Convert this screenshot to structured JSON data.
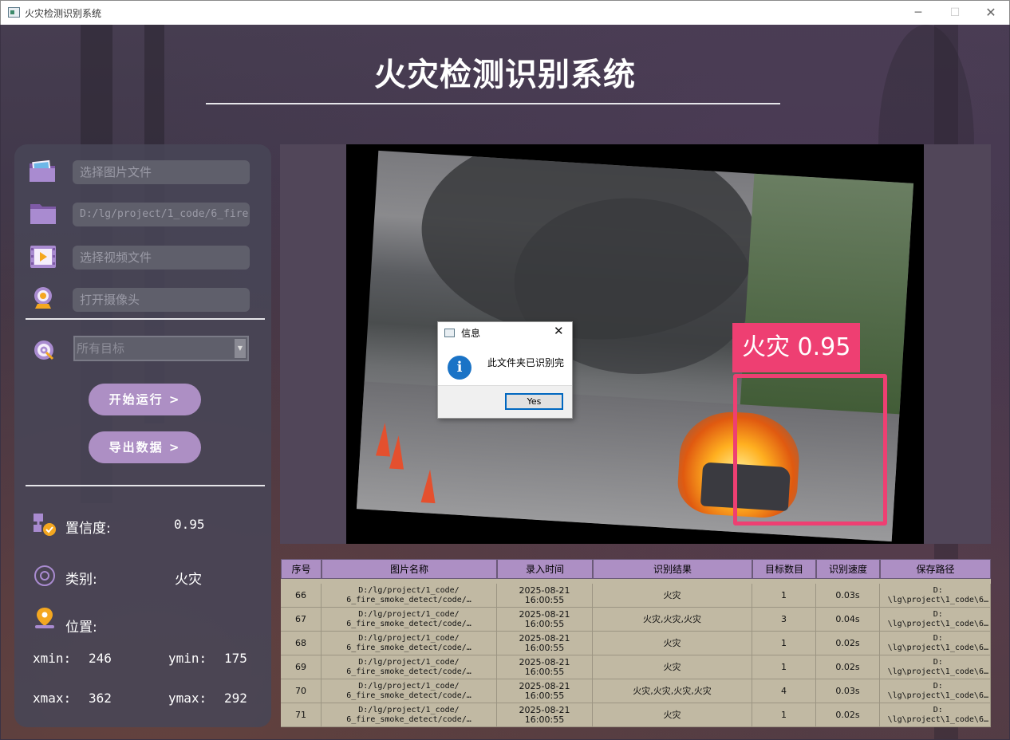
{
  "window": {
    "title": "火灾检测识别系统",
    "controls": {
      "minimize": "─",
      "maximize": "☐",
      "close": "✕"
    }
  },
  "header": {
    "title": "火灾检测识别系统"
  },
  "sidebar": {
    "image_file": {
      "placeholder": "选择图片文件",
      "icon": "image-folder-icon"
    },
    "folder": {
      "value": "D:/lg/project/1_code/6_fire",
      "icon": "folder-icon"
    },
    "video_file": {
      "placeholder": "选择视频文件",
      "icon": "video-icon"
    },
    "camera": {
      "placeholder": "打开摄像头",
      "icon": "webcam-icon"
    },
    "target_select": {
      "value": "所有目标",
      "icon": "target-icon"
    },
    "start_button": "开始运行 >",
    "export_button": "导出数据 >",
    "confidence": {
      "label": "置信度:",
      "value": "0.95"
    },
    "category": {
      "label": "类别:",
      "value": "火灾"
    },
    "position": {
      "label": "位置:",
      "xmin_label": "xmin:",
      "xmin": "246",
      "ymin_label": "ymin:",
      "ymin": "175",
      "xmax_label": "xmax:",
      "xmax": "362",
      "ymax_label": "ymax:",
      "ymax": "292"
    }
  },
  "detection": {
    "label": "火灾 0.95",
    "box_color": "#ee3f72"
  },
  "dialog": {
    "title": "信息",
    "message": "此文件夹已识别完",
    "yes_button": "Yes",
    "info_icon": "i"
  },
  "table": {
    "columns": [
      "序号",
      "图片名称",
      "录入时间",
      "识别结果",
      "目标数目",
      "识别速度",
      "保存路径"
    ],
    "rows": [
      {
        "id": "66",
        "name": "D:/lg/project/1_code/\n6_fire_smoke_detect/code/…",
        "time": "2025-08-21\n16:00:55",
        "result": "火灾",
        "count": "1",
        "speed": "0.03s",
        "path": "D:\n\\lg\\project\\1_code\\6…"
      },
      {
        "id": "67",
        "name": "D:/lg/project/1_code/\n6_fire_smoke_detect/code/…",
        "time": "2025-08-21\n16:00:55",
        "result": "火灾,火灾,火灾",
        "count": "3",
        "speed": "0.04s",
        "path": "D:\n\\lg\\project\\1_code\\6…"
      },
      {
        "id": "68",
        "name": "D:/lg/project/1_code/\n6_fire_smoke_detect/code/…",
        "time": "2025-08-21\n16:00:55",
        "result": "火灾",
        "count": "1",
        "speed": "0.02s",
        "path": "D:\n\\lg\\project\\1_code\\6…"
      },
      {
        "id": "69",
        "name": "D:/lg/project/1_code/\n6_fire_smoke_detect/code/…",
        "time": "2025-08-21\n16:00:55",
        "result": "火灾",
        "count": "1",
        "speed": "0.02s",
        "path": "D:\n\\lg\\project\\1_code\\6…"
      },
      {
        "id": "70",
        "name": "D:/lg/project/1_code/\n6_fire_smoke_detect/code/…",
        "time": "2025-08-21\n16:00:55",
        "result": "火灾,火灾,火灾,火灾",
        "count": "4",
        "speed": "0.03s",
        "path": "D:\n\\lg\\project\\1_code\\6…"
      },
      {
        "id": "71",
        "name": "D:/lg/project/1_code/\n6_fire_smoke_detect/code/…",
        "time": "2025-08-21\n16:00:55",
        "result": "火灾",
        "count": "1",
        "speed": "0.02s",
        "path": "D:\n\\lg\\project\\1_code\\6…"
      }
    ]
  }
}
